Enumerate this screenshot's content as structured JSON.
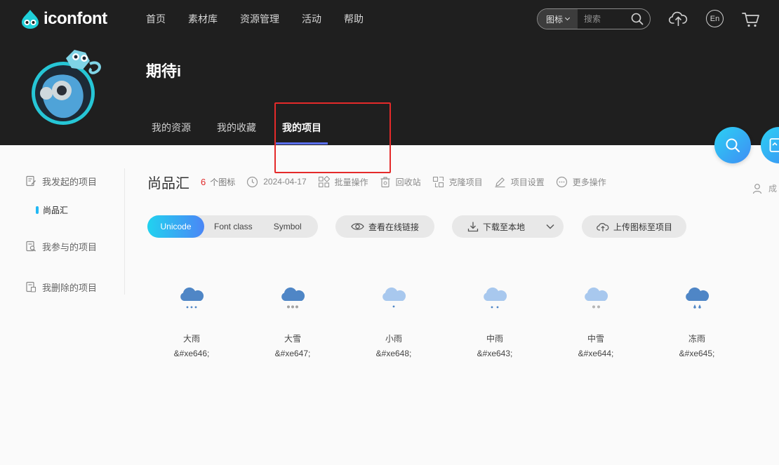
{
  "brand": {
    "name": "iconfont"
  },
  "nav": [
    {
      "label": "首页"
    },
    {
      "label": "素材库"
    },
    {
      "label": "资源管理"
    },
    {
      "label": "活动"
    },
    {
      "label": "帮助"
    }
  ],
  "search": {
    "type_label": "图标",
    "placeholder": "搜索"
  },
  "header_icons": {
    "upload": "upload-cloud-icon",
    "language": "En",
    "cart": "cart-icon"
  },
  "user": {
    "name": "期待i"
  },
  "tabs": [
    {
      "label": "我的资源",
      "active": false
    },
    {
      "label": "我的收藏",
      "active": false
    },
    {
      "label": "我的项目",
      "active": true
    }
  ],
  "sidebar": {
    "initiated": {
      "label": "我发起的项目",
      "projects": [
        {
          "label": "尚品汇"
        }
      ]
    },
    "participated": {
      "label": "我参与的项目"
    },
    "deleted": {
      "label": "我删除的项目"
    }
  },
  "project": {
    "title": "尚品汇",
    "count": "6",
    "count_label": "个图标",
    "date": "2024-04-17",
    "actions": {
      "batch": "批量操作",
      "recycle": "回收站",
      "clone": "克隆项目",
      "settings": "项目设置",
      "more": "更多操作"
    },
    "member_label": "成"
  },
  "toolbar": {
    "segments": [
      {
        "label": "Unicode",
        "active": true
      },
      {
        "label": "Font class",
        "active": false
      },
      {
        "label": "Symbol",
        "active": false
      }
    ],
    "view_link": "查看在线链接",
    "download": "下载至本地",
    "upload": "上传图标至项目"
  },
  "icons": [
    {
      "name": "大雨",
      "code": "&#xe646;",
      "icon": "heavy-rain-icon"
    },
    {
      "name": "大雪",
      "code": "&#xe647;",
      "icon": "heavy-snow-icon"
    },
    {
      "name": "小雨",
      "code": "&#xe648;",
      "icon": "light-rain-icon"
    },
    {
      "name": "中雨",
      "code": "&#xe643;",
      "icon": "moderate-rain-icon"
    },
    {
      "name": "中雪",
      "code": "&#xe644;",
      "icon": "moderate-snow-icon"
    },
    {
      "name": "冻雨",
      "code": "&#xe645;",
      "icon": "freezing-rain-icon"
    }
  ],
  "colors": {
    "header_bg": "#1f1f1f",
    "accent_gradient_start": "#21d2ef",
    "accent_gradient_end": "#4b86f6",
    "tab_underline": "#5a6ff0",
    "count_red": "#e02828",
    "highlight_red": "#e42a2a",
    "cloud_dark": "#4f86c6",
    "cloud_light": "#a8c8ee"
  }
}
